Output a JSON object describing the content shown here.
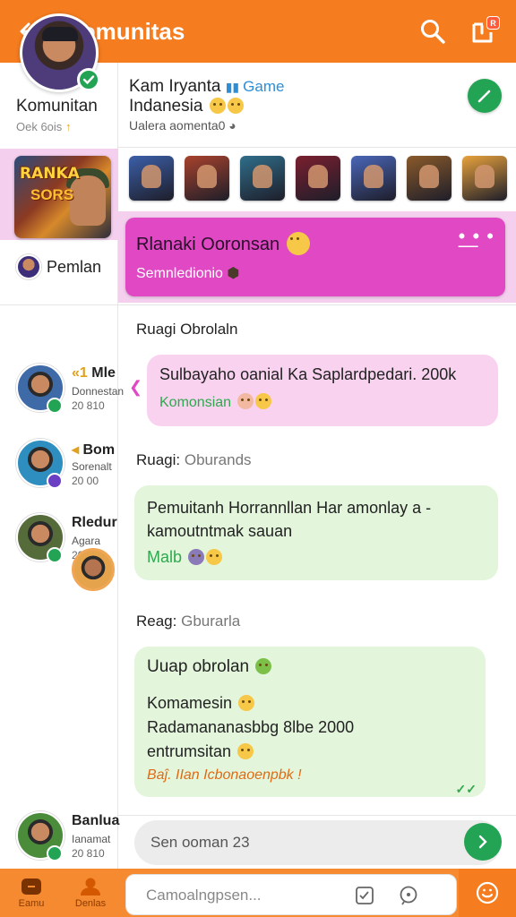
{
  "header": {
    "title": "Komunitas",
    "notif_badge": "R"
  },
  "profile": {
    "name": "Komunitan",
    "sub": "Oek 6ois"
  },
  "community": {
    "title": "Kam Iryanta",
    "game_tag": "Game",
    "subtitle": "Indanesia",
    "meta": "Ualera aomenta0"
  },
  "gallery_colors": [
    "#3b5fa8",
    "#a8422c",
    "#2f6e8a",
    "#7a1f2f",
    "#4a66b8",
    "#8a5a2a",
    "#e8a23c"
  ],
  "pinned": {
    "title": "Rlanaki Ooronsan",
    "sub": "Semnledionio"
  },
  "sidebar": {
    "game_title_line1": "RANKA",
    "game_title_line2": "SORS",
    "pemain_label": "Pemlan",
    "players": [
      {
        "name": "Mle",
        "prefix": "«1",
        "role": "Donnestan",
        "time": "20 810",
        "status_color": "#23a455",
        "avatar_bg": "#3f6aa8"
      },
      {
        "name": "Bom",
        "prefix": "◂",
        "role": "Sorenalt",
        "time": "20 00",
        "status_color": "#6a3fc4",
        "avatar_bg": "#2f8ec0"
      },
      {
        "name": "Rledur",
        "prefix": "",
        "role": "Agara",
        "time": "20 810",
        "status_color": "#23a455",
        "avatar_bg": "#556b3a"
      },
      {
        "name": "Banlua",
        "prefix": "",
        "role": "Ianamat",
        "time": "20 810",
        "status_color": "#23a455",
        "avatar_bg": "#4a8c3a"
      }
    ]
  },
  "chat": {
    "section1": "Ruagi Obrolaln",
    "msg1_line1": "Sulbayaho oanial Ka Saplardpedari. 200k",
    "msg1_line2": "Komonsian",
    "section2_label": "Ruagi:",
    "section2_muted": "Oburands",
    "msg2_line1": "Pemuitanh Horrannllan Har amonlay a",
    "msg2_line2": "kamoutntmak sauan",
    "msg2_line3": "Malb",
    "section3_label": "Reag:",
    "section3_muted": "Gburarla",
    "msg3_title": "Uuap obrolan",
    "msg3_line1": "Komamesin",
    "msg3_line2": "Radamananasbbg 8lbe 2000",
    "msg3_line3": "entrumsitan",
    "msg3_note": "Baĵ. IIan Icbonaoenpbk !",
    "recent_placeholder": "Sen ooman 23"
  },
  "bottom": {
    "nav1": "Eamu",
    "nav2": "Denlas",
    "compose_placeholder": "Camoalngpsen..."
  }
}
